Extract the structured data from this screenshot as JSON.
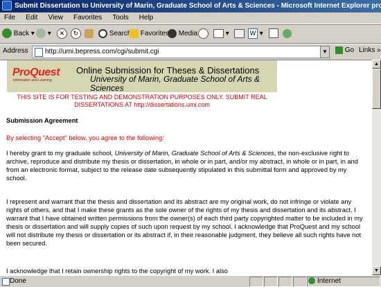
{
  "window": {
    "title": "Submit Dissertation to University of Marin, Graduate School of Arts & Sciences - Microsoft Internet Explorer provided by ProQue"
  },
  "menu": [
    "File",
    "Edit",
    "View",
    "Favorites",
    "Tools",
    "Help"
  ],
  "toolbar": {
    "back": "Back",
    "search": "Search",
    "favorites": "Favorites",
    "media": "Media"
  },
  "address": {
    "label": "Address",
    "url": "http://umi.bepress.com/cgi/submit.cgi",
    "go": "Go",
    "links": "Links"
  },
  "banner": {
    "logo_text": "ProQuest",
    "logo_sub": "Information and Learning",
    "title": "Online Submission for Theses & Dissertations",
    "subtitle": "University of Marin, Graduate School of Arts & Sciences"
  },
  "warning": "THIS SITE IS FOR TESTING AND DEMONSTRATION PURPOSES ONLY. SUBMIT REAL DISSERTATIONS AT http://dissertations.umi.com",
  "agreement": {
    "heading": "Submission Agreement",
    "intro": "By selecting \"Accept\" below, you agree to the following:",
    "p1_a": "I hereby grant to my graduate school, ",
    "p1_school": "University of Marin, Graduate School of Arts & Sciences",
    "p1_b": ", the non-exclusive right to archive, reproduce and distribute my thesis or dissertation, in whole or in part, and/or my abstract, in whole or in part, in and from an electronic format, subject to the release date subsequently stipulated in this submittal form and approved by my school.",
    "p2": "I represent and warrant that the thesis and dissertation and its abstract are my original work, do not infringe or violate any rights of others, and that I make these grants as the sole owner of the rights of my thesis and dissertation and its abstract. I warrant that I have obtained written permissions from the owner(s) of each third party copyrighted matter to be included in my thesis or dissertation and will supply copies of such upon request by my school. I acknowledge that ProQuest and my school will not distribute my thesis or dissertation or its abstract if, in their reasonable judgment, they believe all such rights have not been secured.",
    "p3": "I acknowledge that I retain ownership rights to the copyright of my work. I also"
  },
  "status": {
    "text": "Done",
    "zone": "Internet"
  },
  "colors": {
    "title_bar": "#0a246a",
    "banner_bg": "#d6d7b2",
    "warning": "#d40000",
    "logo": "#e8231d"
  }
}
